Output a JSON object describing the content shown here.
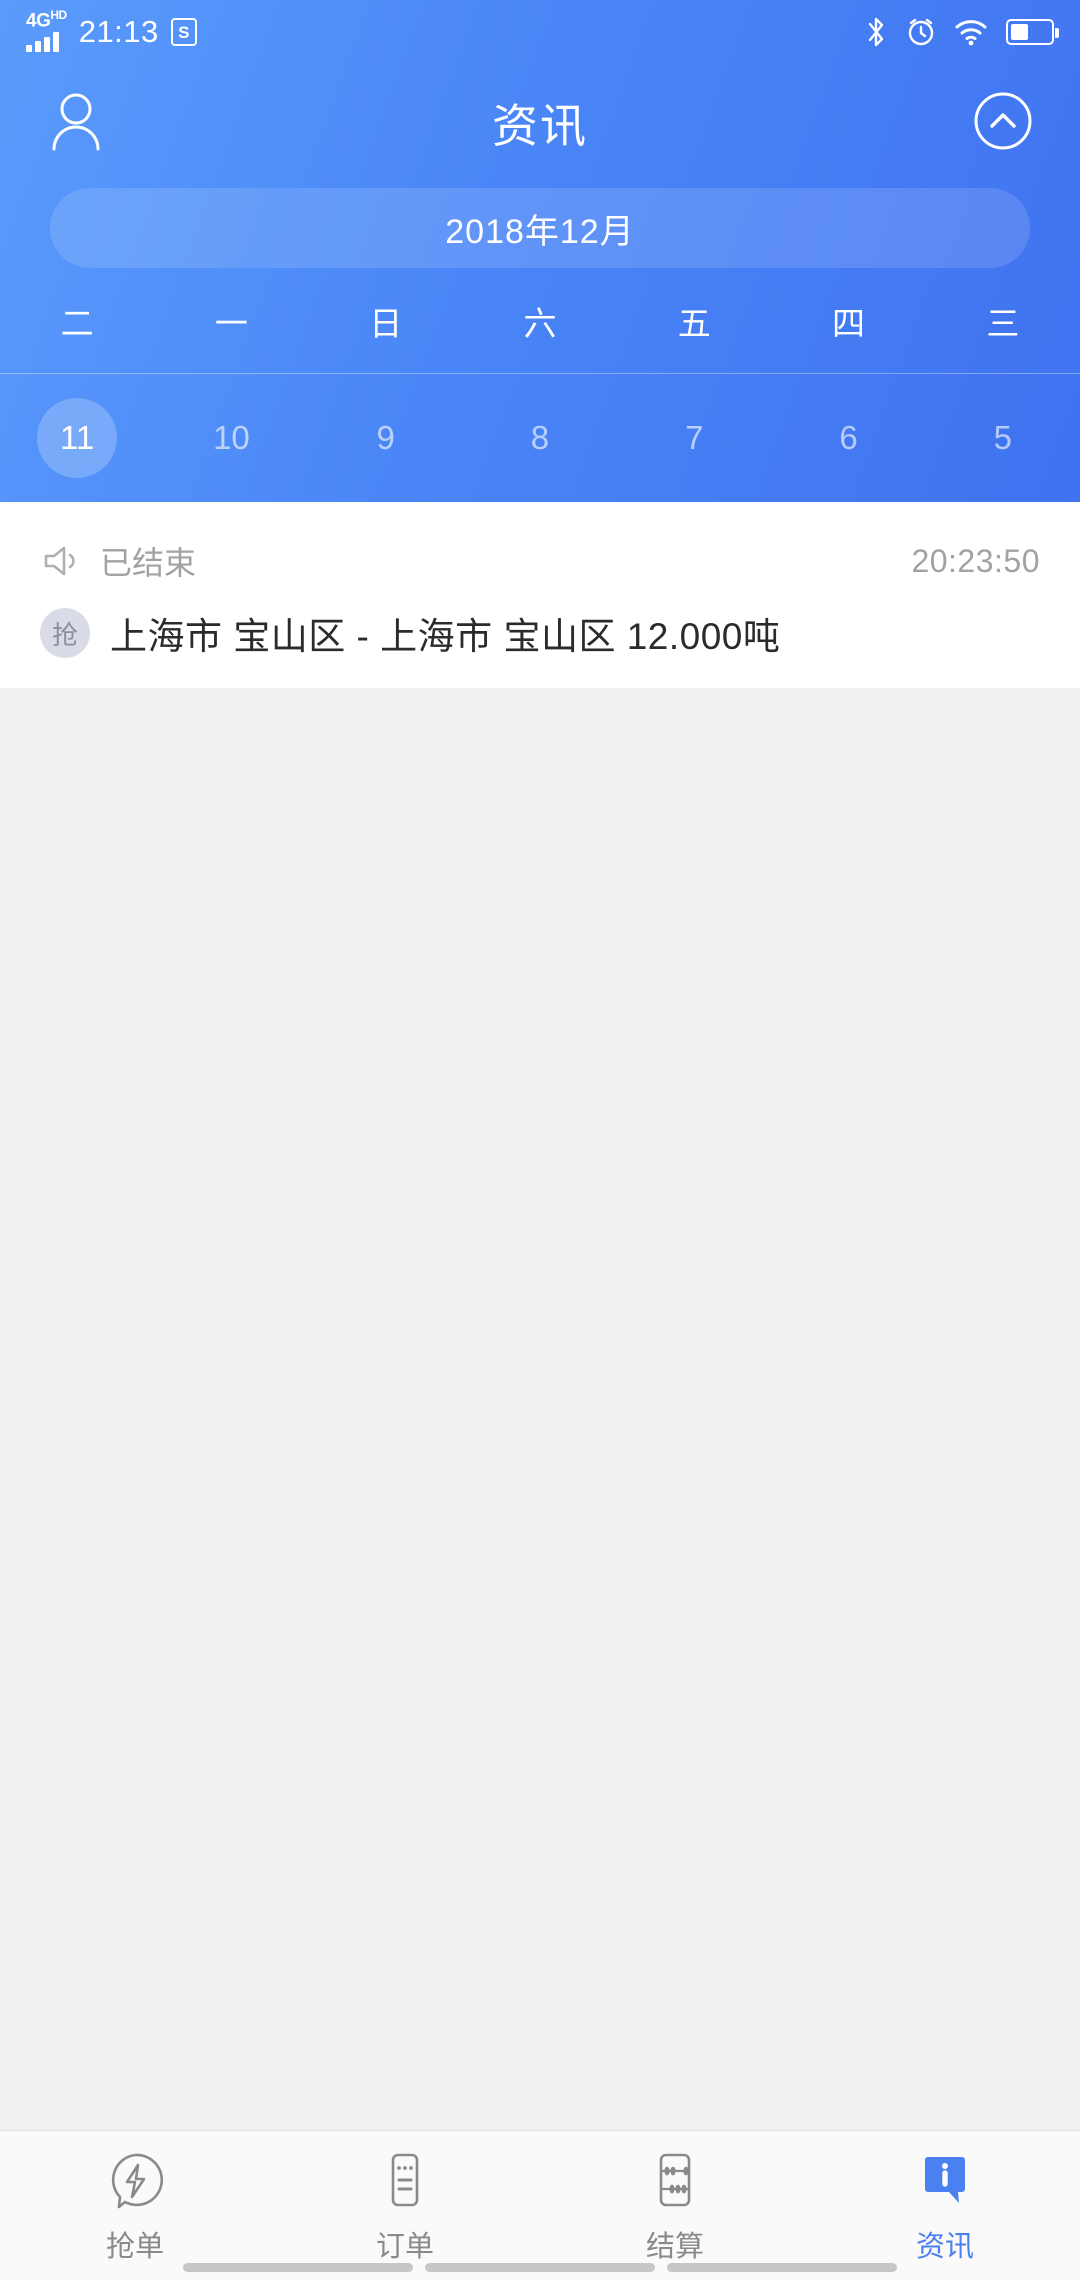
{
  "status_bar": {
    "network_type": "4G",
    "network_sup": "HD",
    "time": "21:13",
    "sim_icon_label": "S",
    "icons": [
      "bluetooth-icon",
      "alarm-icon",
      "wifi-icon",
      "battery-icon"
    ]
  },
  "header": {
    "title": "资讯",
    "left_icon": "profile-icon",
    "right_icon": "chevron-up-circle-icon"
  },
  "calendar": {
    "month_label": "2018年12月",
    "weekdays": [
      "二",
      "一",
      "日",
      "六",
      "五",
      "四",
      "三"
    ],
    "days": [
      {
        "num": "11",
        "selected": true
      },
      {
        "num": "10",
        "selected": false
      },
      {
        "num": "9",
        "selected": false
      },
      {
        "num": "8",
        "selected": false
      },
      {
        "num": "7",
        "selected": false
      },
      {
        "num": "6",
        "selected": false
      },
      {
        "num": "5",
        "selected": false
      }
    ]
  },
  "list": {
    "items": [
      {
        "status_icon": "megaphone-icon",
        "status": "已结束",
        "time": "20:23:50",
        "badge": "抢",
        "route": "上海市 宝山区 - 上海市 宝山区   12.000吨"
      }
    ]
  },
  "tabbar": {
    "active_color": "#4a80f0",
    "items": [
      {
        "label": "抢单",
        "icon": "lightning-bubble-icon",
        "active": false
      },
      {
        "label": "订单",
        "icon": "order-list-icon",
        "active": false
      },
      {
        "label": "结算",
        "icon": "abacus-icon",
        "active": false
      },
      {
        "label": "资讯",
        "icon": "info-bubble-icon",
        "active": true
      }
    ]
  }
}
